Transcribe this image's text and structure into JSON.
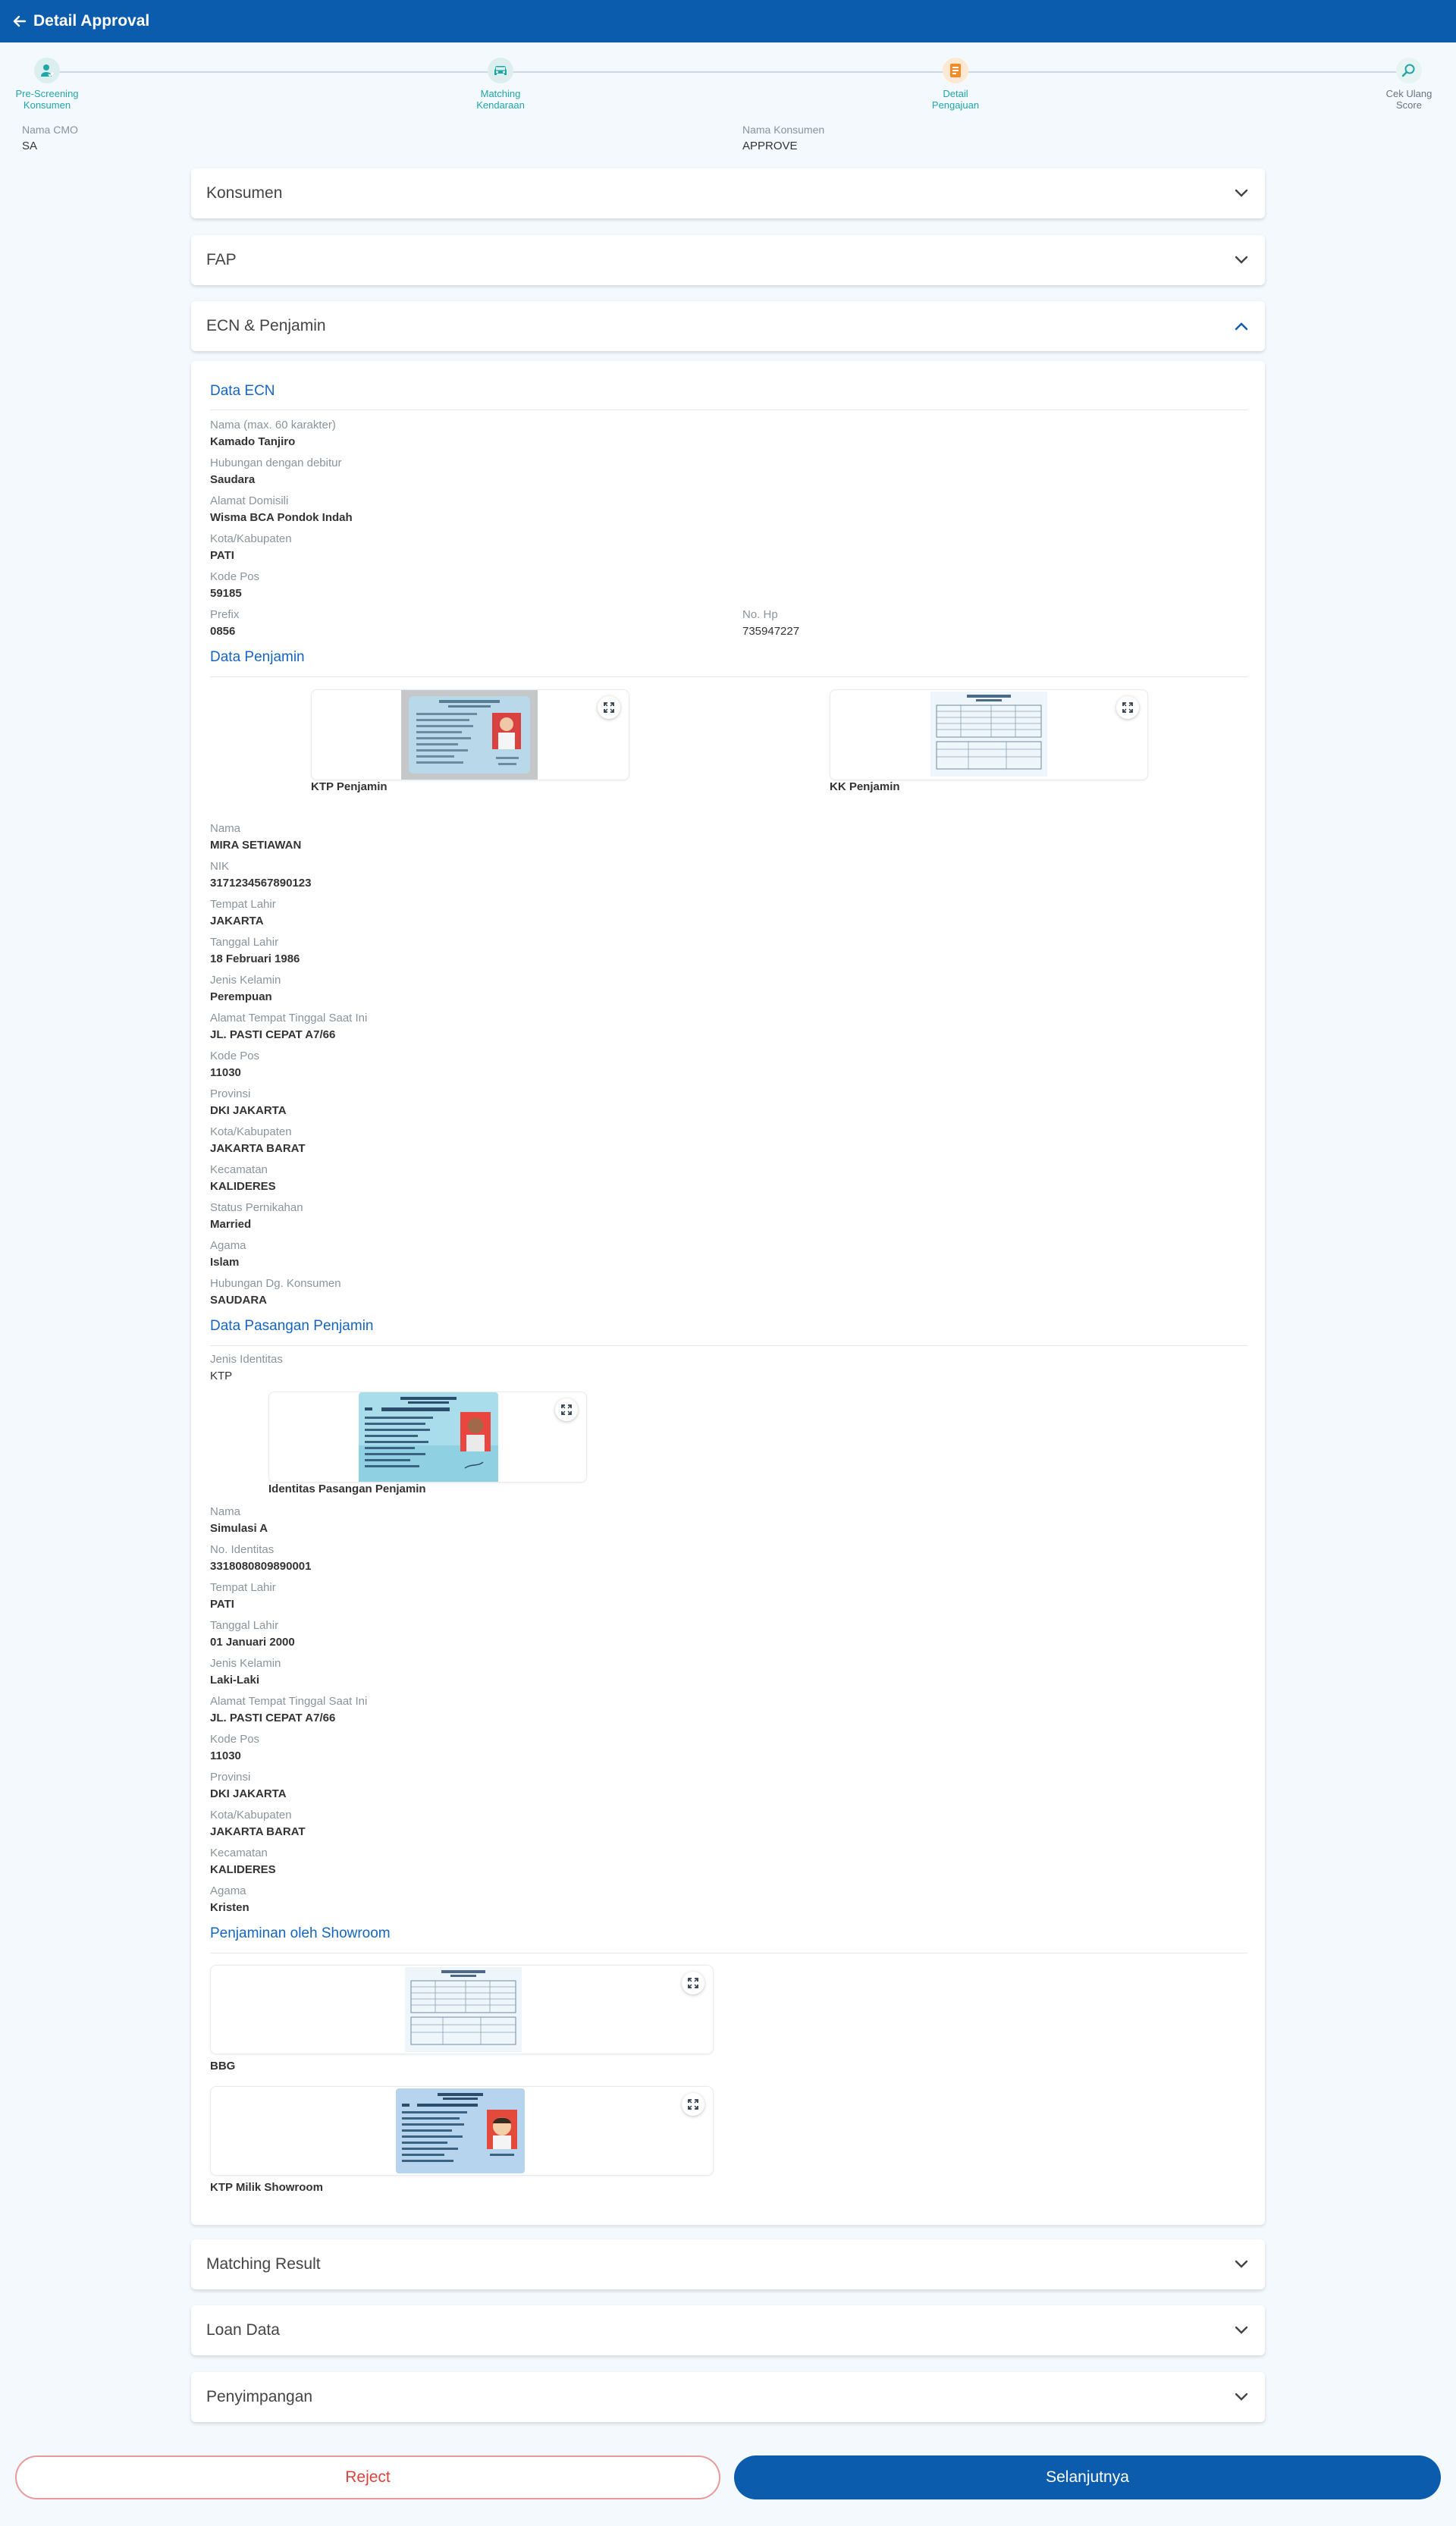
{
  "header": {
    "title": "Detail Approval",
    "back_icon": "arrow-left-icon"
  },
  "stepper": {
    "steps": [
      {
        "label": "Pre-Screening Konsumen",
        "icon": "user-check-icon",
        "state": "done"
      },
      {
        "label": "Matching Kendaraan",
        "icon": "car-icon",
        "state": "done"
      },
      {
        "label": "Detail Pengajuan",
        "icon": "document-icon",
        "state": "active"
      },
      {
        "label": "Cek Ulang Score",
        "icon": "magnifier-icon",
        "state": "pending"
      }
    ]
  },
  "meta": {
    "nama_cmo_label": "Nama CMO",
    "nama_cmo": "SA",
    "nama_konsumen_label": "Nama Konsumen",
    "nama_konsumen": "APPROVE"
  },
  "accordions": {
    "konsumen": "Konsumen",
    "fap": "FAP",
    "ecn_penjamin": "ECN & Penjamin",
    "matching_result": "Matching Result",
    "loan_data": "Loan Data",
    "penyimpangan": "Penyimpangan"
  },
  "ecn": {
    "title": "Data ECN",
    "fields": [
      {
        "label": "Nama (max. 60 karakter)",
        "value": "Kamado Tanjiro"
      },
      {
        "label": "Hubungan dengan debitur",
        "value": "Saudara"
      },
      {
        "label": "Alamat Domisili",
        "value": "Wisma BCA Pondok Indah"
      },
      {
        "label": "Kota/Kabupaten",
        "value": "PATI"
      },
      {
        "label": "Kode Pos",
        "value": "59185"
      },
      {
        "label": "Prefix",
        "value": "0856"
      }
    ],
    "no_hp_label": "No. Hp",
    "no_hp": "735947227"
  },
  "penjamin": {
    "title": "Data Penjamin",
    "ktp_caption": "KTP Penjamin",
    "kk_caption": "KK Penjamin",
    "fields": [
      {
        "label": "Nama",
        "value": "MIRA SETIAWAN"
      },
      {
        "label": "NIK",
        "value": "3171234567890123"
      },
      {
        "label": "Tempat Lahir",
        "value": "JAKARTA"
      },
      {
        "label": "Tanggal Lahir",
        "value": "18 Februari 1986"
      },
      {
        "label": "Jenis Kelamin",
        "value": "Perempuan"
      },
      {
        "label": "Alamat Tempat Tinggal Saat Ini",
        "value": "JL. PASTI CEPAT A7/66"
      },
      {
        "label": "Kode Pos",
        "value": "11030"
      },
      {
        "label": "Provinsi",
        "value": "DKI JAKARTA"
      },
      {
        "label": "Kota/Kabupaten",
        "value": "JAKARTA BARAT"
      },
      {
        "label": "Kecamatan",
        "value": "KALIDERES"
      },
      {
        "label": "Status Pernikahan",
        "value": "Married"
      },
      {
        "label": "Agama",
        "value": "Islam"
      },
      {
        "label": "Hubungan Dg. Konsumen",
        "value": "SAUDARA"
      }
    ]
  },
  "pasangan": {
    "title": "Data Pasangan Penjamin",
    "jenis_identitas_label": "Jenis Identitas",
    "jenis_identitas": "KTP",
    "identitas_caption": "Identitas Pasangan Penjamin",
    "fields": [
      {
        "label": "Nama",
        "value": "Simulasi A"
      },
      {
        "label": "No. Identitas",
        "value": "3318080809890001"
      },
      {
        "label": "Tempat Lahir",
        "value": "PATI"
      },
      {
        "label": "Tanggal Lahir",
        "value": "01 Januari 2000"
      },
      {
        "label": "Jenis Kelamin",
        "value": "Laki-Laki"
      },
      {
        "label": "Alamat Tempat Tinggal Saat Ini",
        "value": "JL. PASTI CEPAT A7/66"
      },
      {
        "label": "Kode Pos",
        "value": "11030"
      },
      {
        "label": "Provinsi",
        "value": "DKI JAKARTA"
      },
      {
        "label": "Kota/Kabupaten",
        "value": "JAKARTA BARAT"
      },
      {
        "label": "Kecamatan",
        "value": "KALIDERES"
      },
      {
        "label": "Agama",
        "value": "Kristen"
      }
    ]
  },
  "showroom": {
    "title": "Penjaminan oleh Showroom",
    "bbg_caption": "BBG",
    "ktp_caption": "KTP Milik Showroom"
  },
  "buttons": {
    "reject": "Reject",
    "next": "Selanjutnya"
  }
}
